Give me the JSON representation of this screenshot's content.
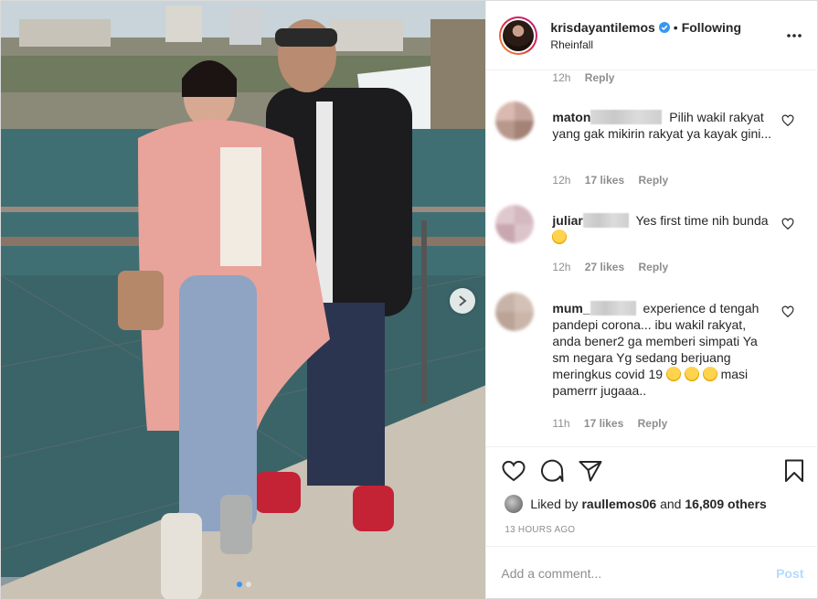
{
  "header": {
    "username": "krisdayantilemos",
    "separator": "•",
    "following_label": "Following",
    "location": "Rheinfall",
    "icons": {
      "verified": "verified-badge-icon",
      "more": "more-options-icon"
    }
  },
  "comments": {
    "top_meta": {
      "time": "12h",
      "reply": "Reply"
    },
    "items": [
      {
        "user": "maton",
        "text": "Pilih wakil rakyat yang gak mikirin rakyat ya kayak gini...",
        "time": "12h",
        "likes": "17 likes",
        "reply": "Reply"
      },
      {
        "user": "juliar",
        "text": "Yes first time nih bunda",
        "time": "12h",
        "likes": "27 likes",
        "reply": "Reply"
      },
      {
        "user": "mum_",
        "text": "experience d tengah pandepi corona... ibu wakil rakyat, anda bener2 ga memberi simpati Ya sm negara Yg sedang berjuang meringkus covid 19",
        "text_after": "masi pamerrr jugaaa..",
        "time": "11h",
        "likes": "17 likes",
        "reply": "Reply"
      }
    ]
  },
  "actions": {
    "liked_prefix": "Liked by",
    "liked_user": "raullemos06",
    "liked_and": "and",
    "liked_others": "16,809 others",
    "time_ago": "13 HOURS AGO",
    "icons": [
      "heart-icon",
      "comment-icon",
      "share-icon",
      "bookmark-icon"
    ]
  },
  "add_comment": {
    "placeholder": "Add a comment...",
    "post_label": "Post"
  },
  "carousel": {
    "current_index": 1,
    "total": 2
  },
  "colors": {
    "accent_blue": "#3897f0",
    "post_disabled": "#b3dbff",
    "meta_gray": "#8e8e8e",
    "text": "#262626"
  }
}
